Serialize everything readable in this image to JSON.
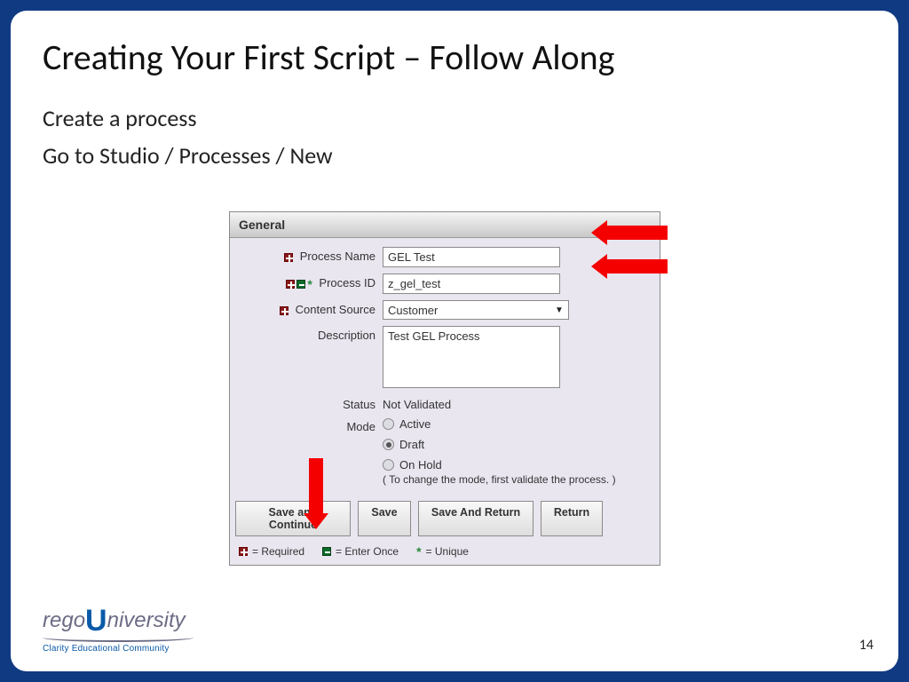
{
  "title": "Creating Your First Script – Follow Along",
  "body_line1": "Create a process",
  "body_line2": "Go to Studio / Processes / New",
  "form": {
    "section_title": "General",
    "labels": {
      "process_name": "Process Name",
      "process_id": "Process ID",
      "content_source": "Content Source",
      "description": "Description",
      "status": "Status",
      "mode": "Mode"
    },
    "values": {
      "process_name": "GEL Test",
      "process_id": "z_gel_test",
      "content_source": "Customer",
      "description": "Test GEL Process",
      "status": "Not Validated"
    },
    "mode_options": {
      "active": "Active",
      "draft": "Draft",
      "on_hold": "On Hold"
    },
    "mode_hint": "( To change the mode, first validate the process. )",
    "buttons": {
      "save_continue": "Save and Continue",
      "save": "Save",
      "save_return": "Save And Return",
      "return": "Return"
    },
    "legend": {
      "required": "= Required",
      "enter_once": "= Enter Once",
      "unique": "= Unique"
    }
  },
  "footer": {
    "page_number": "14",
    "logo_rego": "rego",
    "logo_niversity": "niversity",
    "logo_tag": "Clarity Educational Community"
  }
}
